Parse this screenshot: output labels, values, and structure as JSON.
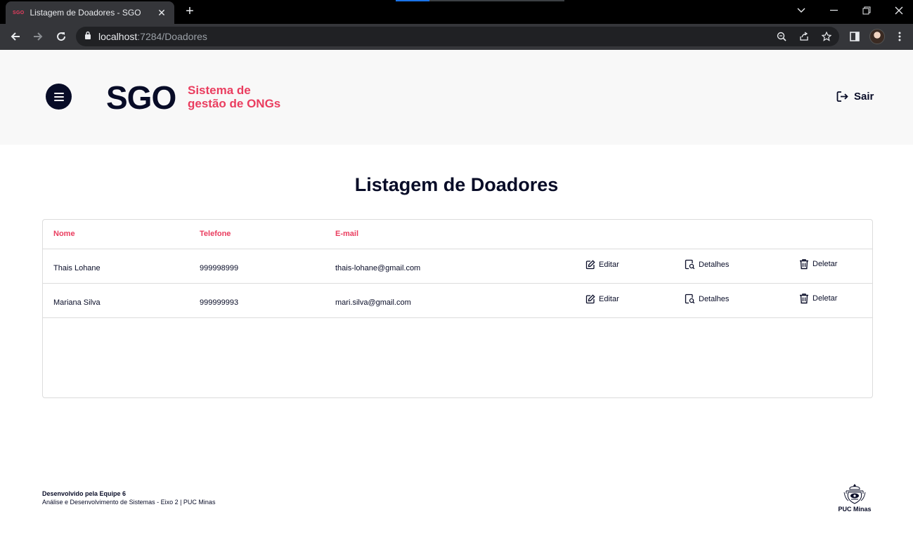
{
  "browser": {
    "tab_favicon_text": "SGO",
    "tab_title": "Listagem de Doadores - SGO",
    "tab_close": "✕",
    "new_tab": "+",
    "url_host": "localhost",
    "url_rest": ":7284/Doadores"
  },
  "header": {
    "logo_main": "SGO",
    "logo_sub_line1": "Sistema de",
    "logo_sub_line2": "gestão de ONGs",
    "logout_label": "Sair"
  },
  "main": {
    "title": "Listagem de Doadores",
    "columns": [
      "Nome",
      "Telefone",
      "E-mail"
    ],
    "rows": [
      {
        "nome": "Thais Lohane",
        "telefone": "999998999",
        "email": "thais-lohane@gmail.com"
      },
      {
        "nome": "Mariana Silva",
        "telefone": "999999993",
        "email": "mari.silva@gmail.com"
      }
    ],
    "actions": {
      "edit": "Editar",
      "details": "Detalhes",
      "delete": "Deletar"
    }
  },
  "footer": {
    "line1": "Desenvolvido pela Equipe 6",
    "line2": "Análise e Desenvolvimento de Sistemas - Eixo 2 | PUC Minas",
    "logo_label": "PUC Minas"
  },
  "colors": {
    "navy": "#080c27",
    "accent": "#ea3d5f",
    "header_bg": "#f8f8f8"
  }
}
